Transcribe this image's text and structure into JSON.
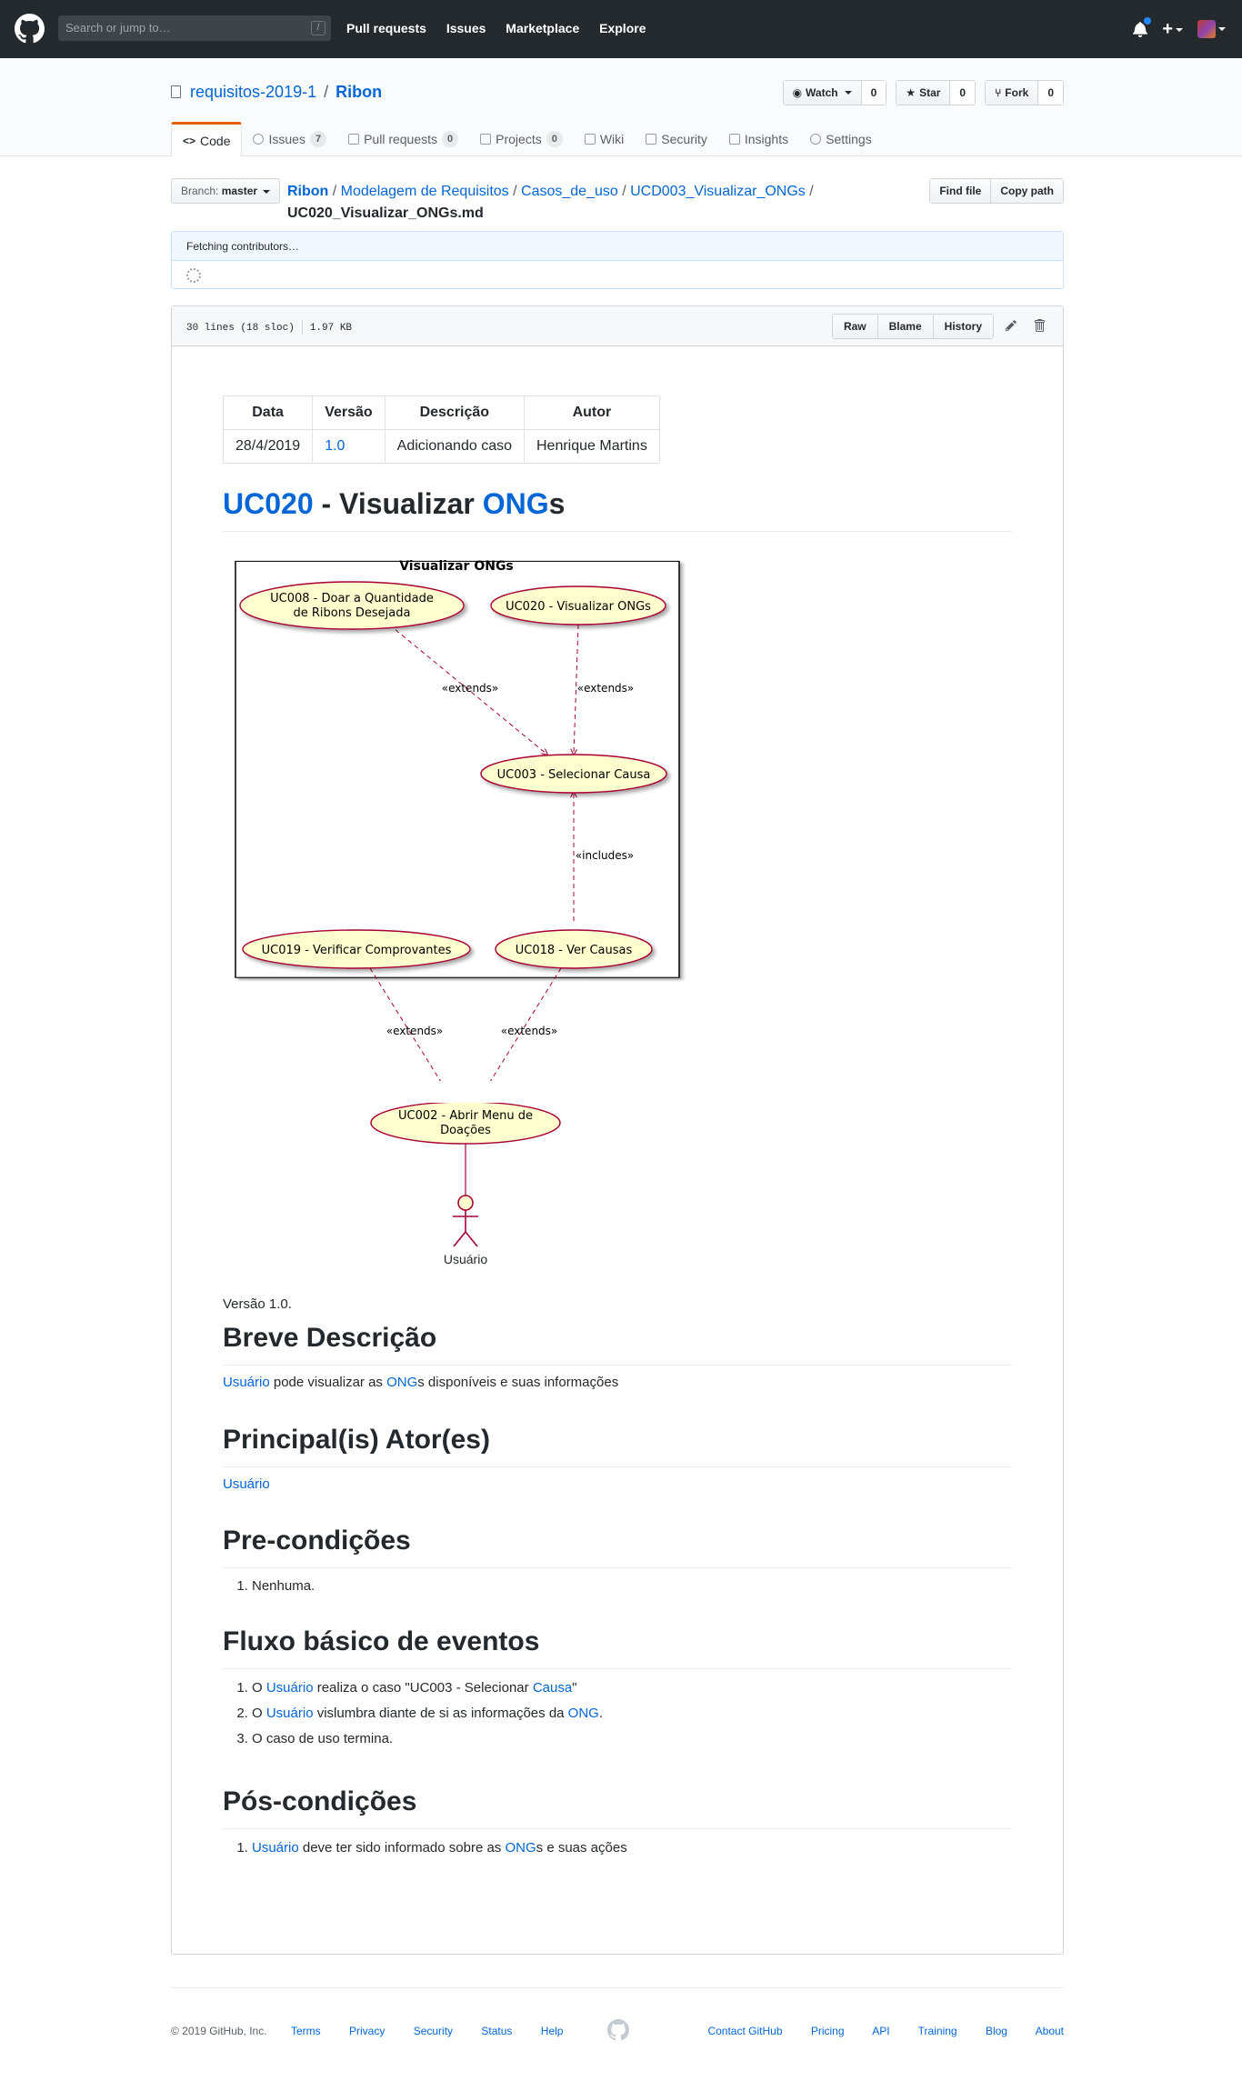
{
  "header": {
    "search_placeholder": "Search or jump to…",
    "search_key": "/",
    "nav": [
      "Pull requests",
      "Issues",
      "Marketplace",
      "Explore"
    ],
    "plus_label": "+"
  },
  "repo": {
    "owner": "requisitos-2019-1",
    "separator": "/",
    "name": "Ribon",
    "watch_label": "Watch",
    "watch_count": "0",
    "star_label": "Star",
    "star_count": "0",
    "fork_label": "Fork",
    "fork_count": "0",
    "tabs": [
      {
        "label": "Code",
        "count": ""
      },
      {
        "label": "Issues",
        "count": "7"
      },
      {
        "label": "Pull requests",
        "count": "0"
      },
      {
        "label": "Projects",
        "count": "0"
      },
      {
        "label": "Wiki",
        "count": ""
      },
      {
        "label": "Security",
        "count": ""
      },
      {
        "label": "Insights",
        "count": ""
      },
      {
        "label": "Settings",
        "count": ""
      }
    ]
  },
  "breadcrumb": {
    "branch_prefix": "Branch:",
    "branch": "master",
    "root": "Ribon",
    "parts": [
      "Modelagem de Requisitos",
      "Casos_de_uso",
      "UCD003_Visualizar_ONGs"
    ],
    "file": "UC020_Visualizar_ONGs.md",
    "find_file": "Find file",
    "copy_path": "Copy path"
  },
  "contributors": {
    "status": "Fetching contributors…"
  },
  "file": {
    "lines": "30 lines (18 sloc)",
    "size": "1.97 KB",
    "raw": "Raw",
    "blame": "Blame",
    "history": "History"
  },
  "doc": {
    "table": {
      "headers": [
        "Data",
        "Versão",
        "Descrição",
        "Autor"
      ],
      "row": [
        "28/4/2019",
        "1.0",
        "Adicionando caso",
        "Henrique Martins"
      ]
    },
    "title_link1": "UC020",
    "title_mid": " - Visualizar ",
    "title_link2": "ONG",
    "title_end": "s",
    "diagram": {
      "boundary": "Visualizar ONGs",
      "uc008_l1": "UC008 - Doar a Quantidade",
      "uc008_l2": "de Ribons Desejada",
      "uc020": "UC020 - Visualizar ONGs",
      "uc003": "UC003 - Selecionar Causa",
      "uc019": "UC019 - Verificar Comprovantes",
      "uc018": "UC018 - Ver Causas",
      "uc002_l1": "UC002 - Abrir Menu de",
      "uc002_l2": "Doações",
      "extends": "«extends»",
      "includes": "«includes»",
      "actor": "Usuário",
      "colors": {
        "usecase_fill": "#fefece",
        "usecase_stroke": "#a80036"
      }
    },
    "version_text": "Versão 1.0.",
    "h_breve": "Breve Descrição",
    "breve": {
      "link1": "Usuário",
      "t1": " pode visualizar as ",
      "link2": "ONG",
      "t2": "s disponíveis e suas informações"
    },
    "h_atores": "Principal(is) Ator(es)",
    "atores_link": "Usuário",
    "h_pre": "Pre-condições",
    "pre_item": "Nenhuma.",
    "h_fluxo": "Fluxo básico de eventos",
    "fluxo": {
      "i1_a": "O ",
      "i1_link": "Usuário",
      "i1_b": " realiza o caso \"UC003 - Selecionar ",
      "i1_link2": "Causa",
      "i1_c": "\"",
      "i2_a": "O ",
      "i2_link": "Usuário",
      "i2_b": " vislumbra diante de si as informações da ",
      "i2_link2": "ONG",
      "i2_c": ".",
      "i3": "O caso de uso termina."
    },
    "h_pos": "Pós-condições",
    "pos": {
      "link1": "Usuário",
      "t1": " deve ter sido informado sobre as ",
      "link2": "ONG",
      "t2": "s e suas ações"
    }
  },
  "footer": {
    "copyright": "© 2019 GitHub, Inc.",
    "left_links": [
      "Terms",
      "Privacy",
      "Security",
      "Status",
      "Help"
    ],
    "right_links": [
      "Contact GitHub",
      "Pricing",
      "API",
      "Training",
      "Blog",
      "About"
    ]
  }
}
